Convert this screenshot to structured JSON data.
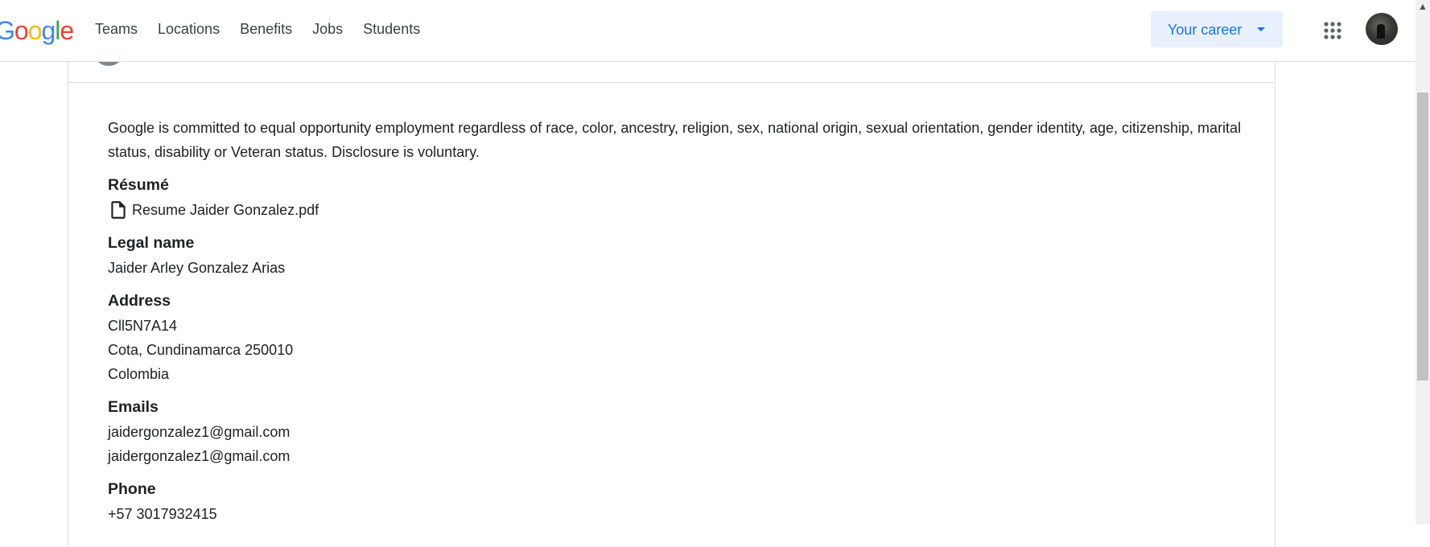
{
  "header": {
    "logo_letters": [
      {
        "ch": "G",
        "color": "#4285F4"
      },
      {
        "ch": "o",
        "color": "#EA4335"
      },
      {
        "ch": "o",
        "color": "#FBBC05"
      },
      {
        "ch": "g",
        "color": "#4285F4"
      },
      {
        "ch": "l",
        "color": "#34A853"
      },
      {
        "ch": "e",
        "color": "#EA4335"
      }
    ],
    "nav": [
      "Teams",
      "Locations",
      "Benefits",
      "Jobs",
      "Students"
    ],
    "career_button": "Your career",
    "apps_icon": "apps-grid-icon",
    "avatar_icon": "user-avatar"
  },
  "application": {
    "disclaimer": "Google is committed to equal opportunity employment regardless of race, color, ancestry, religion, sex, national origin, sexual orientation, gender identity, age, citizenship, marital status, disability or Veteran status. Disclosure is voluntary.",
    "resume": {
      "title": "Résumé",
      "file_icon": "document-icon",
      "file_name": "Resume Jaider Gonzalez.pdf"
    },
    "legal_name": {
      "title": "Legal name",
      "value": "Jaider Arley Gonzalez Arias"
    },
    "address": {
      "title": "Address",
      "lines": [
        "Cll5N7A14",
        "Cota, Cundinamarca 250010",
        "Colombia"
      ]
    },
    "emails": {
      "title": "Emails",
      "values": [
        "jaidergonzalez1@gmail.com",
        "jaidergonzalez1@gmail.com"
      ]
    },
    "phone": {
      "title": "Phone",
      "value": "+57 3017932415"
    }
  },
  "colors": {
    "accent": "#1a73e8",
    "accent_bg": "#e8f0fe",
    "border": "#dadce0",
    "text": "#202124"
  }
}
